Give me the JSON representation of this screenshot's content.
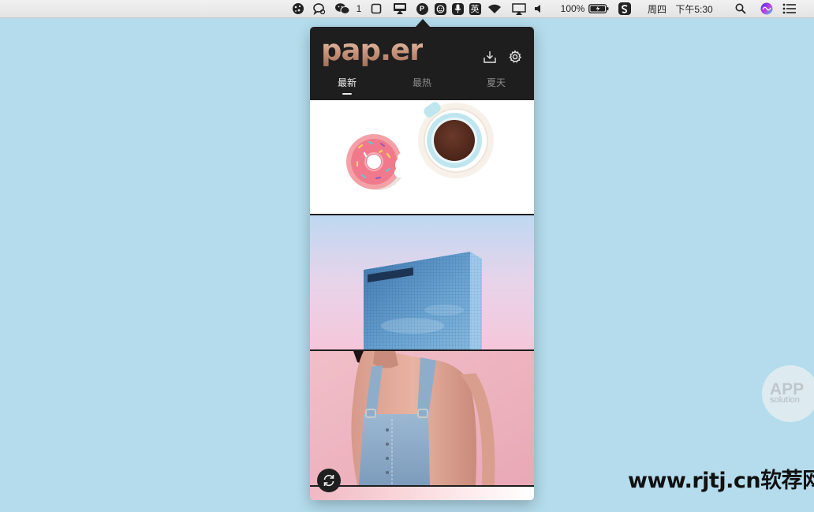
{
  "menubar": {
    "wechat_count": "1",
    "input_method": "英",
    "battery": "100%",
    "day": "周四",
    "time": "下午5:30",
    "paper_icon_letter": "P",
    "icons": [
      "globe-icon",
      "chat-bubble-icon",
      "wechat-icon",
      "window-icon",
      "airplay-display-icon",
      "paper-app-icon",
      "face-icon",
      "microphone-icon",
      "input-method-icon",
      "wifi-icon",
      "airplay-icon",
      "volume-icon",
      "battery-icon",
      "sogou-icon",
      "spotlight-icon",
      "siri-icon",
      "notification-center-icon"
    ]
  },
  "popover": {
    "logo": "pap.er",
    "header_buttons": [
      "download-icon",
      "gear-icon"
    ],
    "tabs": [
      {
        "label": "最新",
        "active": true
      },
      {
        "label": "最热",
        "active": false
      },
      {
        "label": "夏天",
        "active": false
      }
    ],
    "wallpapers": [
      "donut-and-coffee",
      "blue-glass-building",
      "denim-overalls-portrait",
      "pink-gradient"
    ],
    "refresh_icon": "refresh-icon"
  },
  "watermark": {
    "badge_main": "APP",
    "badge_sub": "solution",
    "site": "www.rjtj.cn软荐网"
  },
  "colors": {
    "desktop": "#b4dcec",
    "popover_header": "#1e1e1e",
    "logo_gradient": [
      "#f3d6bf",
      "#9f6e55"
    ]
  }
}
